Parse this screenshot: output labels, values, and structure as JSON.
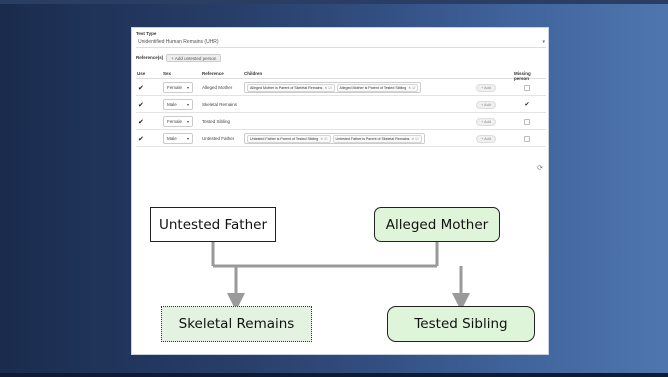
{
  "form": {
    "test_type_label": "Test Type",
    "test_type_value": "Unidentified Human Remains (UHR)",
    "references_label": "Reference(s)",
    "add_untested_label": "+ Add untested person"
  },
  "table": {
    "headers": {
      "use": "Use",
      "sex": "Sex",
      "reference": "Reference",
      "children": "Children",
      "missing": "Missing person"
    },
    "rows": [
      {
        "use": "✔",
        "sex": "Female",
        "reference": "Alleged Mother",
        "children": [
          "Alleged Mother is Parent of Skeletal Remains",
          "Alleged Mother is Parent of Tested Sibling"
        ],
        "add": "+ Add",
        "missing": ""
      },
      {
        "use": "✔",
        "sex": "Male",
        "reference": "Skeletal Remains",
        "children": [],
        "add": "+ Add",
        "missing": "✔"
      },
      {
        "use": "✔",
        "sex": "Female",
        "reference": "Tested Sibling",
        "children": [],
        "add": "+ Add",
        "missing": ""
      },
      {
        "use": "✔",
        "sex": "Male",
        "reference": "Untested Father",
        "children": [
          "Untested Father is Parent of Tested Sibling",
          "Untested Father is Parent of Skeletal Remains"
        ],
        "add": "+ Add",
        "missing": ""
      }
    ]
  },
  "diagram": {
    "father": "Untested Father",
    "mother": "Alleged Mother",
    "skeletal": "Skeletal Remains",
    "sibling": "Tested Sibling"
  },
  "icons": {
    "refresh": "refresh-icon",
    "caret": "chevron-down-icon",
    "check": "checkmark-icon",
    "edit": "edit-icon",
    "remove": "close-icon"
  },
  "colors": {
    "node_green": "#dff5da",
    "edge_gray": "#9a9a9a",
    "background": "#1c2f52"
  }
}
